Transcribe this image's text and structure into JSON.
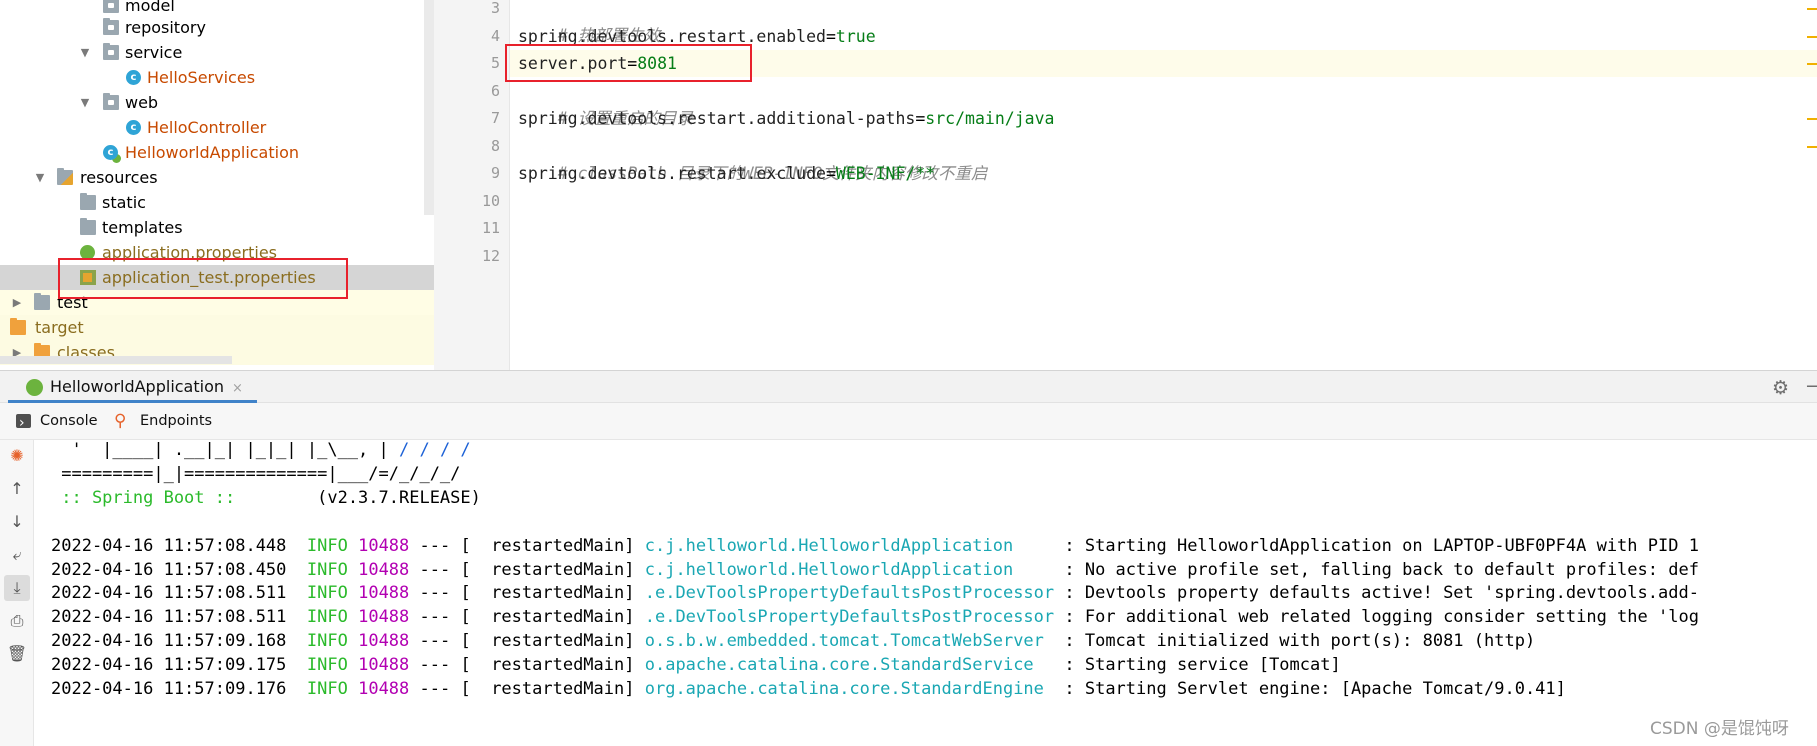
{
  "project_tree": {
    "items": [
      {
        "label": "model",
        "icon": "package-folder-icon",
        "kind": "package"
      },
      {
        "label": "repository",
        "icon": "package-folder-icon",
        "kind": "package"
      },
      {
        "label": "service",
        "icon": "package-folder-icon",
        "kind": "package",
        "expanded": true
      },
      {
        "label": "HelloServices",
        "icon": "java-class-icon",
        "kind": "class"
      },
      {
        "label": "web",
        "icon": "package-folder-icon",
        "kind": "package",
        "expanded": true
      },
      {
        "label": "HelloController",
        "icon": "java-class-icon",
        "kind": "class"
      },
      {
        "label": "HelloworldApplication",
        "icon": "spring-boot-class-icon",
        "kind": "class"
      },
      {
        "label": "resources",
        "icon": "resources-folder-icon",
        "kind": "folder",
        "expanded": true
      },
      {
        "label": "static",
        "icon": "folder-icon",
        "kind": "folder"
      },
      {
        "label": "templates",
        "icon": "folder-icon",
        "kind": "folder"
      },
      {
        "label": "application.properties",
        "icon": "spring-properties-icon",
        "kind": "file"
      },
      {
        "label": "application_test.properties",
        "icon": "properties-file-icon",
        "kind": "file",
        "selected": true
      },
      {
        "label": "test",
        "icon": "folder-icon",
        "kind": "folder",
        "collapsed": true
      },
      {
        "label": "target",
        "icon": "excluded-folder-icon",
        "kind": "folder"
      },
      {
        "label": "classes",
        "icon": "excluded-folder-icon",
        "kind": "folder",
        "collapsed": true
      }
    ]
  },
  "editor": {
    "line_numbers": [
      "3",
      "4",
      "5",
      "6",
      "7",
      "8",
      "9",
      "10",
      "11",
      "12"
    ],
    "lines": [
      {
        "comment": "# 热部署生效"
      },
      {
        "key": "spring.devtools.restart.enabled",
        "eq": "=",
        "value": "true"
      },
      {
        "key": "server.port",
        "eq": "=",
        "value": "8081",
        "current": true
      },
      {
        "comment": "# 设置重启的目录"
      },
      {
        "key": "spring.devtools.restart.additional-paths",
        "eq": "=",
        "value": "src/main/java"
      },
      {
        "comment": "# classPath 目录下的WEB-INFO文件夹内容修改不重启"
      },
      {
        "key": "spring.devtools.restart.exclude",
        "eq": "=",
        "value": "WEB-INF/**"
      },
      {},
      {},
      {}
    ]
  },
  "run_window": {
    "tab_title": "HelloworldApplication",
    "close_glyph": "×",
    "settings_icon": "gear-icon",
    "minimize_glyph": "—",
    "subtabs": {
      "console": "Console",
      "endpoints": "Endpoints"
    },
    "banner": {
      "line1_a": "  '  |____| .__|_| |_|_| |_\\__, | ",
      "line1_b": "/ / / /",
      "line2": " =========|_|==============|___/=/_/_/_/",
      "line3_a": " :: Spring Boot :: ",
      "line3_b": "       (v2.3.7.RELEASE)"
    },
    "log_rows": [
      {
        "ts": "2022-04-16 11:57:08.448",
        "level": "INFO",
        "pid": "10488",
        "sep": "--- [",
        "thread": "  restartedMain]",
        "logger": "c.j.helloworld.HelloworldApplication    ",
        "msg": " : Starting HelloworldApplication on LAPTOP-UBF0PF4A with PID 1"
      },
      {
        "ts": "2022-04-16 11:57:08.450",
        "level": "INFO",
        "pid": "10488",
        "sep": "--- [",
        "thread": "  restartedMain]",
        "logger": "c.j.helloworld.HelloworldApplication    ",
        "msg": " : No active profile set, falling back to default profiles: def"
      },
      {
        "ts": "2022-04-16 11:57:08.511",
        "level": "INFO",
        "pid": "10488",
        "sep": "--- [",
        "thread": "  restartedMain]",
        "logger": ".e.DevToolsPropertyDefaultsPostProcessor",
        "msg": " : Devtools property defaults active! Set 'spring.devtools.add-"
      },
      {
        "ts": "2022-04-16 11:57:08.511",
        "level": "INFO",
        "pid": "10488",
        "sep": "--- [",
        "thread": "  restartedMain]",
        "logger": ".e.DevToolsPropertyDefaultsPostProcessor",
        "msg": " : For additional web related logging consider setting the 'log"
      },
      {
        "ts": "2022-04-16 11:57:09.168",
        "level": "INFO",
        "pid": "10488",
        "sep": "--- [",
        "thread": "  restartedMain]",
        "logger": "o.s.b.w.embedded.tomcat.TomcatWebServer ",
        "msg": " : Tomcat initialized with port(s): 8081 (http)"
      },
      {
        "ts": "2022-04-16 11:57:09.175",
        "level": "INFO",
        "pid": "10488",
        "sep": "--- [",
        "thread": "  restartedMain]",
        "logger": "o.apache.catalina.core.StandardService  ",
        "msg": " : Starting service [Tomcat]"
      },
      {
        "ts": "2022-04-16 11:57:09.176",
        "level": "INFO",
        "pid": "10488",
        "sep": "--- [",
        "thread": "  restartedMain]",
        "logger": "org.apache.catalina.core.StandardEngine ",
        "msg": " : Starting Servlet engine: [Apache Tomcat/9.0.41]"
      }
    ]
  },
  "watermark": "CSDN @是馄饨呀",
  "colors": {
    "highlight_box": "#e8212c",
    "info_level": "#2bba2b",
    "pid": "#b200b2",
    "logger": "#1aa7b3",
    "prop_value": "#067d17",
    "tab_underline": "#4083c9"
  }
}
